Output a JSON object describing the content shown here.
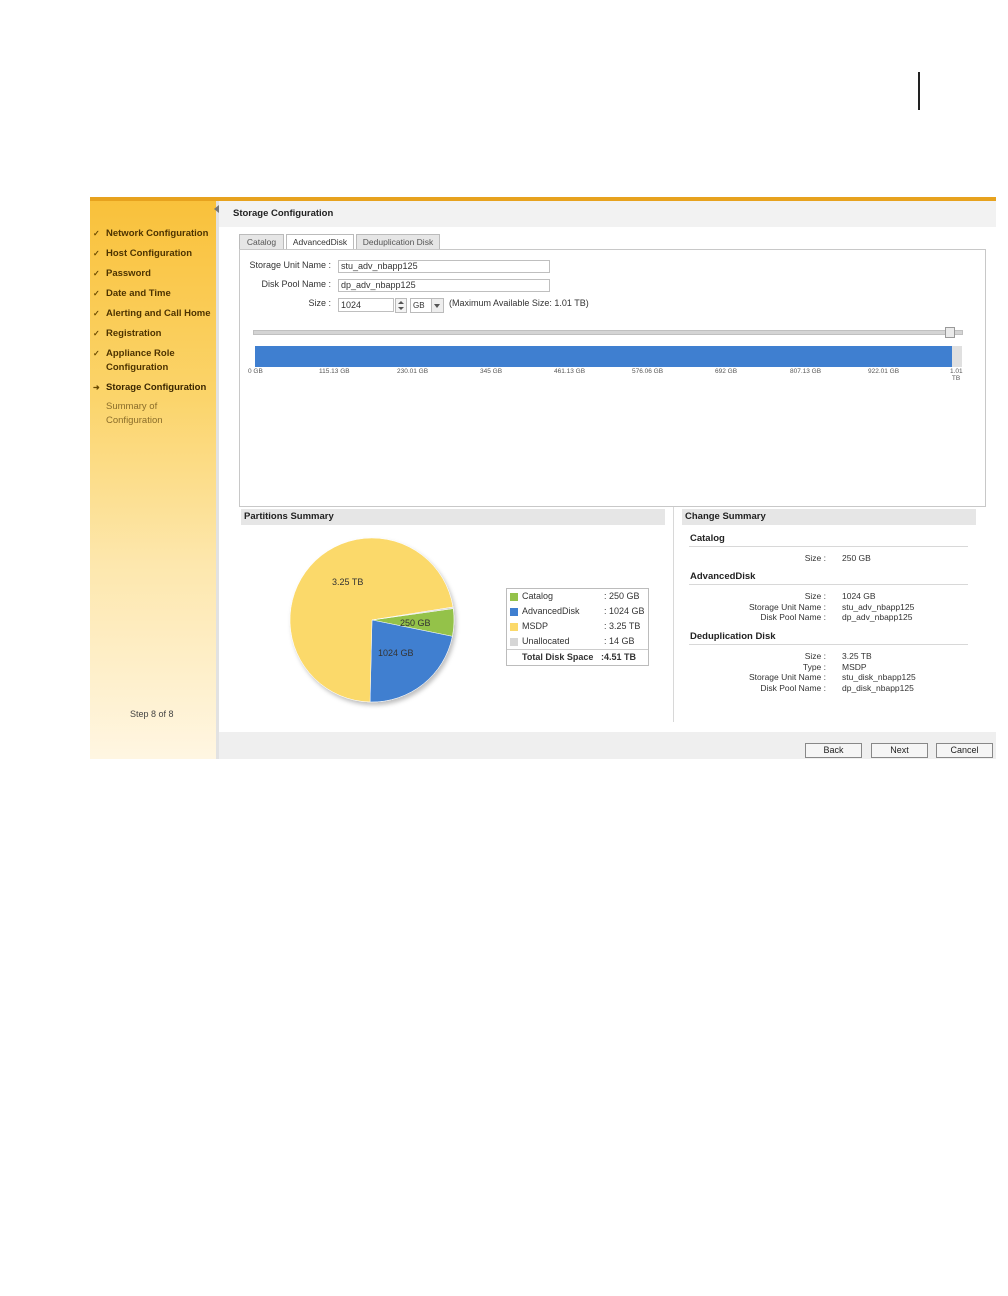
{
  "sidebar": {
    "items": [
      {
        "label": "Network Configuration",
        "mark": "✓"
      },
      {
        "label": "Host Configuration",
        "mark": "✓"
      },
      {
        "label": "Password",
        "mark": "✓"
      },
      {
        "label": "Date and Time",
        "mark": "✓"
      },
      {
        "label": "Alerting and Call Home",
        "mark": "✓"
      },
      {
        "label": "Registration",
        "mark": "✓"
      },
      {
        "label": "Appliance Role Configuration",
        "mark": "✓"
      },
      {
        "label": "Storage Configuration",
        "mark": "➜"
      },
      {
        "label": "Summary of Configuration",
        "mark": ""
      }
    ],
    "step": "Step 8 of 8"
  },
  "header": {
    "title": "Storage Configuration"
  },
  "tabs": [
    {
      "label": "Catalog"
    },
    {
      "label": "AdvancedDisk"
    },
    {
      "label": "Deduplication Disk"
    }
  ],
  "form": {
    "storage_unit_label": "Storage Unit Name :",
    "storage_unit_value": "stu_adv_nbapp125",
    "disk_pool_label": "Disk Pool Name :",
    "disk_pool_value": "dp_adv_nbapp125",
    "size_label": "Size :",
    "size_value": "1024",
    "size_unit": "GB",
    "max_note": "(Maximum Available Size: 1.01 TB)"
  },
  "slider": {
    "ticks": [
      "0 GB",
      "115.13 GB",
      "230.01 GB",
      "345 GB",
      "461.13 GB",
      "576.06 GB",
      "692 GB",
      "807.13 GB",
      "922.01 GB",
      "1.01 TB"
    ],
    "fill_fraction": 0.986
  },
  "partitions": {
    "title": "Partitions Summary",
    "slice_labels": {
      "msdp": "3.25 TB",
      "catalog": "250 GB",
      "advanced": "1024 GB"
    },
    "legend": [
      {
        "name": "Catalog",
        "value": ": 250 GB",
        "color": "#94c24a"
      },
      {
        "name": "AdvancedDisk",
        "value": ": 1024 GB",
        "color": "#3f7fd0"
      },
      {
        "name": "MSDP",
        "value": ": 3.25 TB",
        "color": "#fbd96a"
      },
      {
        "name": "Unallocated",
        "value": ": 14 GB",
        "color": "#d6d6d6"
      }
    ],
    "total_label": "Total Disk Space",
    "total_value": ":4.51 TB"
  },
  "change_summary": {
    "title": "Change Summary",
    "catalog": {
      "heading": "Catalog",
      "size_k": "Size :",
      "size_v": "250 GB"
    },
    "advanced": {
      "heading": "AdvancedDisk",
      "size_k": "Size :",
      "size_v": "1024 GB",
      "stu_k": "Storage Unit Name :",
      "stu_v": "stu_adv_nbapp125",
      "dp_k": "Disk Pool Name :",
      "dp_v": "dp_adv_nbapp125"
    },
    "dedup": {
      "heading": "Deduplication Disk",
      "size_k": "Size :",
      "size_v": "3.25 TB",
      "type_k": "Type :",
      "type_v": "MSDP",
      "stu_k": "Storage Unit Name :",
      "stu_v": "stu_disk_nbapp125",
      "dp_k": "Disk Pool Name :",
      "dp_v": "dp_disk_nbapp125"
    }
  },
  "footer": {
    "back": "Back",
    "next": "Next",
    "cancel": "Cancel"
  },
  "chart_data": {
    "type": "pie",
    "categories": [
      "Catalog",
      "AdvancedDisk",
      "MSDP",
      "Unallocated"
    ],
    "values": [
      250,
      1024,
      3328,
      14
    ],
    "unit": "GB",
    "title": "Partitions Summary"
  }
}
